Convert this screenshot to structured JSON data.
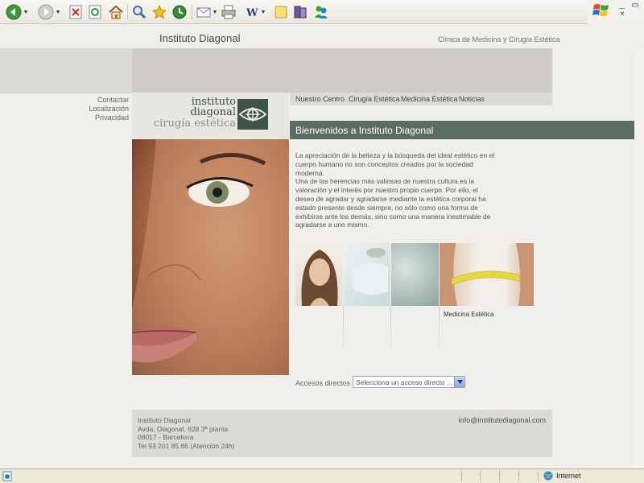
{
  "browser": {
    "toolbar_icons": [
      "back-icon",
      "forward-icon",
      "stop-icon",
      "refresh-icon",
      "home-icon",
      "search-icon",
      "favorites-icon",
      "history-icon",
      "mail-icon",
      "print-icon",
      "edit-icon",
      "discuss-icon",
      "research-icon",
      "messenger-icon"
    ],
    "window_controls": "_ ▭ ×",
    "status": {
      "zone": "Internet"
    }
  },
  "site": {
    "title": "Instituto Diagonal",
    "tagline": "Clínica de Medicina y Cirugía Estética",
    "utility_links": [
      "Contactar",
      "Localización",
      "Privacidad"
    ],
    "logo": {
      "line1": "instituto",
      "line2": "diagonal",
      "line3": "cirugía estética"
    },
    "nav": [
      "Nuestro Centro",
      "Cirugía Estética",
      "Medicina Estética",
      "Noticias"
    ],
    "welcome": "Bienvenidos a Instituto Diagonal",
    "intro": [
      "La apreciación de la belleza y la búsqueda del ideal estético en el cuerpo humano no son conceptos creados por la sociedad moderna.",
      "Una de las herencias más valiosas de nuestra cultura es la valoración y el interés por nuestro propio cuerpo. Por ello, el deseo de agradar y agradarse mediante la estética corporal ha estado presente desde siempre, no sólo como una forma de exhibirse ante los demás, sino como una manera inestimable de agradarse a uno mismo."
    ],
    "thumb_caption": "Medicina Estética",
    "quick_access": {
      "label": "Accesos directos",
      "selected": "Selecciona un acceso directo ..."
    },
    "footer": {
      "address": [
        "Instituto Diagonal",
        "Avda. Diagonal, 628 3ª planta",
        "08017 - Barcelona",
        "Tel 93 201 85 86 (Atención 24h)"
      ],
      "email": "info@institutodiagonal.com"
    }
  },
  "colors": {
    "accent_green": "#5b6d60",
    "logo_green": "#3d5447",
    "band_gray": "#cfcbc7"
  }
}
